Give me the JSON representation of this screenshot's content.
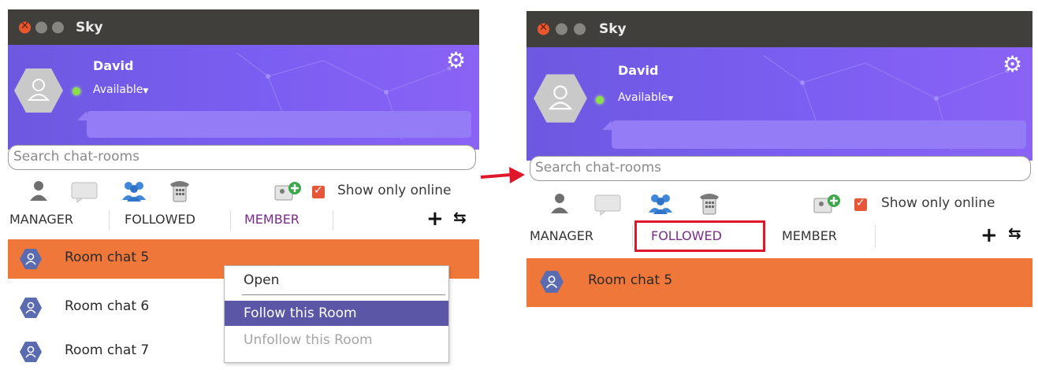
{
  "colors": {
    "accent_purple": "#7b5ef2",
    "selected_row": "#f0773a",
    "menu_highlight": "#5b57a6",
    "callout_red": "#e0162b"
  },
  "left": {
    "title": "Sky",
    "user_name": "David",
    "user_status": "Available",
    "search_placeholder": "Search chat-rooms",
    "show_only_online": "Show only online",
    "tabs": [
      "MANAGER",
      "FOLLOWED",
      "MEMBER"
    ],
    "rooms": [
      "Room chat 5",
      "Room chat 6",
      "Room chat 7"
    ],
    "context_menu": [
      "Open",
      "Follow this Room",
      "Unfollow this Room"
    ]
  },
  "right": {
    "title": "Sky",
    "user_name": "David",
    "user_status": "Available",
    "search_placeholder": "Search chat-rooms",
    "show_only_online": "Show only online",
    "tabs": [
      "MANAGER",
      "FOLLOWED",
      "MEMBER"
    ],
    "rooms": [
      "Room chat 5"
    ]
  },
  "icons": [
    "close-icon",
    "minimize-icon",
    "maximize-icon",
    "settings-gear-icon",
    "user-avatar-icon",
    "contact-icon",
    "chat-bubble-icon",
    "group-icon",
    "phone-icon",
    "add-contact-icon",
    "plus-icon",
    "refresh-icon",
    "room-icon",
    "arrow-right-icon"
  ]
}
